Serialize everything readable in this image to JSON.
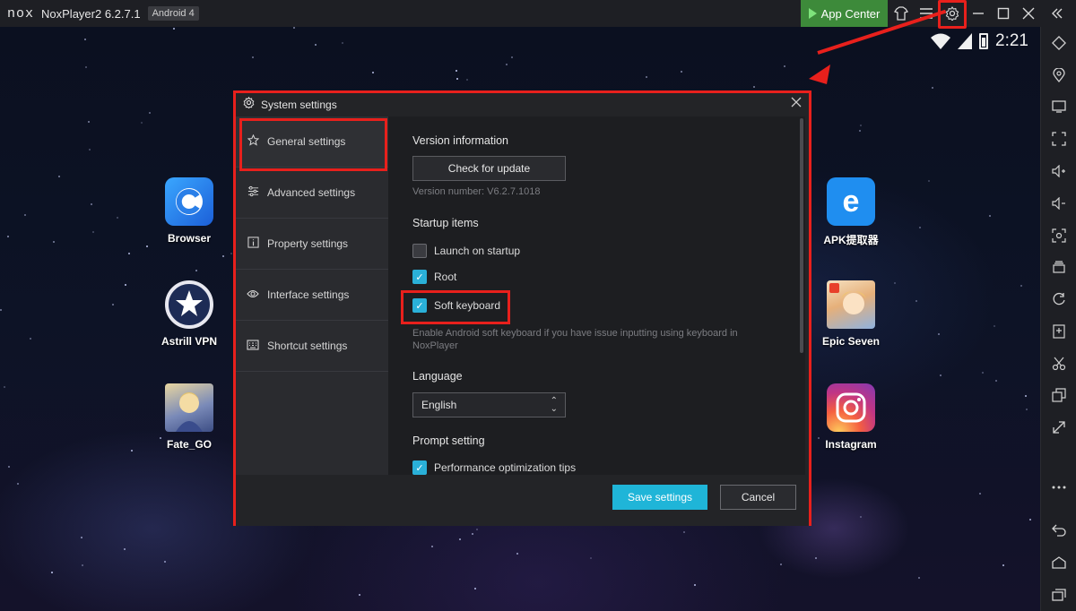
{
  "titlebar": {
    "logo": "nox",
    "title": "NoxPlayer2 6.2.7.1",
    "android_badge": "Android 4",
    "app_center": "App Center",
    "icons": [
      "theme-icon",
      "menu-icon",
      "gear-icon",
      "minimize-icon",
      "maximize-icon",
      "close-icon",
      "collapse-sidebar-icon"
    ]
  },
  "statusbar": {
    "time": "2:21"
  },
  "apps_left": [
    {
      "label": "Browser",
      "icon": "browser-icon"
    },
    {
      "label": "Astrill VPN",
      "icon": "vpn-star-icon"
    },
    {
      "label": "Fate_GO",
      "icon": "fate-go-icon"
    }
  ],
  "apps_right": [
    {
      "label": "APK提取器",
      "icon": "apk-extractor-icon"
    },
    {
      "label": "Epic Seven",
      "icon": "epic-seven-icon"
    },
    {
      "label": "Instagram",
      "icon": "instagram-icon"
    }
  ],
  "dialog": {
    "title": "System settings",
    "nav": [
      {
        "label": "General settings",
        "icon": "star-icon"
      },
      {
        "label": "Advanced settings",
        "icon": "sliders-icon"
      },
      {
        "label": "Property settings",
        "icon": "info-icon"
      },
      {
        "label": "Interface settings",
        "icon": "eye-icon"
      },
      {
        "label": "Shortcut settings",
        "icon": "keyboard-icon"
      }
    ],
    "version": {
      "title": "Version information",
      "button": "Check for update",
      "number": "Version number: V6.2.7.1018"
    },
    "startup": {
      "title": "Startup items",
      "items": [
        {
          "label": "Launch on startup",
          "checked": false
        },
        {
          "label": "Root",
          "checked": true
        },
        {
          "label": "Soft keyboard",
          "checked": true
        }
      ],
      "hint_line1": "Enable Android soft keyboard if you have issue inputting using keyboard in",
      "hint_line2": "NoxPlayer"
    },
    "language": {
      "title": "Language",
      "selected": "English"
    },
    "prompt": {
      "title": "Prompt setting",
      "items": [
        {
          "label": "Performance optimization tips",
          "checked": true
        }
      ]
    },
    "footer": {
      "save": "Save settings",
      "cancel": "Cancel"
    }
  },
  "colors": {
    "accent": "#1fb5d8",
    "highlight": "#e8201c",
    "app_center": "#3d8a3a"
  }
}
